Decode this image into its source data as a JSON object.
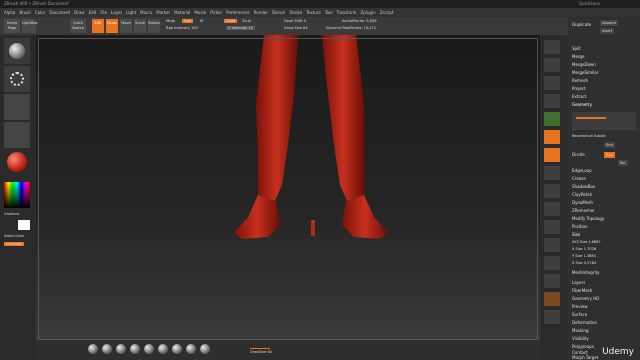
{
  "window": {
    "title": "ZBrush 4R6 • ZBrush Document",
    "right": "QuickSave"
  },
  "menu": [
    "Alpha",
    "Brush",
    "Color",
    "Document",
    "Draw",
    "Edit",
    "File",
    "Layer",
    "Light",
    "Macro",
    "Marker",
    "Material",
    "Movie",
    "Picker",
    "Preferences",
    "Render",
    "Stencil",
    "Stroke",
    "Texture",
    "Tool",
    "Transform",
    "Zplugin",
    "Zscript"
  ],
  "toolbar": {
    "home": "Home Page",
    "lightbox": "LightBox",
    "quick_sketch": "Quick Sketch",
    "edit": "Edit",
    "draw": "Draw",
    "move": "Move",
    "scale": "Scale",
    "rotate": "Rotate",
    "mrgb": "Mrgb",
    "rgb": "Rgb",
    "m": "M",
    "rgb_intensity": "Rgb Intensity 100",
    "zadd": "Zadd",
    "zsub": "Zsub",
    "z_intensity": "Z Intensity 25",
    "focal_shift": "Focal Shift 0",
    "draw_size": "Draw Size 64",
    "dynamic": "Dynamic",
    "active_points": "ActivePoints: 9,628",
    "total_points": "TotalPoints: 19,271"
  },
  "subtitle": "ZBrush Document",
  "left": {
    "gradient": "Gradient",
    "switch_color": "SwitchColor",
    "alternate": "Alternate"
  },
  "right_panel": {
    "items": [
      "Append",
      "Insert",
      "Duplicate",
      "Split",
      "Merge",
      "MergeDown",
      "MergeSimilar",
      "Remesh",
      "Project",
      "Extract",
      "Geometry",
      "Reconstruct Subdiv",
      "Smt",
      "Divide",
      "Suv",
      "Rel",
      "EdgeLoop",
      "Crease",
      "ShadowBox",
      "ClayPolish",
      "DynaMesh",
      "ZRemesher",
      "Modify Topology",
      "Position",
      "Size",
      "XYZ Size 1.8867",
      "X Size 1.7026",
      "Y Size 1.3684",
      "Z Size 0.5784",
      "MeshIntegrity",
      "Layers",
      "FiberMesh",
      "Geometry HD",
      "Preview",
      "Surface",
      "Deformation",
      "Masking",
      "Visibility",
      "Polygroups",
      "Contact",
      "Morph Target"
    ]
  },
  "bottom": {
    "status": "DrawSize 64"
  },
  "watermark": "Udemy"
}
